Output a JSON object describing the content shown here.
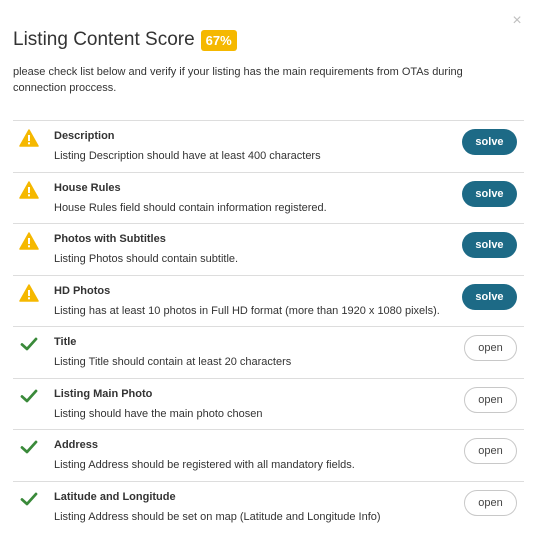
{
  "dialog": {
    "close_glyph": "×",
    "title": "Listing Content Score",
    "score": "67%",
    "subtitle": "please check list below and verify if your listing has the main requirements from OTAs during connection proccess."
  },
  "colors": {
    "warning": "#f5b800",
    "success": "#3a8a3a",
    "solve_button": "#1d6a86",
    "badge": "#f5b800"
  },
  "items": [
    {
      "status": "warning",
      "icon": "warning-icon",
      "title": "Description",
      "description": "Listing Description should have at least 400 characters",
      "action": "solve"
    },
    {
      "status": "warning",
      "icon": "warning-icon",
      "title": "House Rules",
      "description": "House Rules field should contain information registered.",
      "action": "solve"
    },
    {
      "status": "warning",
      "icon": "warning-icon",
      "title": "Photos with Subtitles",
      "description": "Listing Photos should contain subtitle.",
      "action": "solve"
    },
    {
      "status": "warning",
      "icon": "warning-icon",
      "title": "HD Photos",
      "description": "Listing has at least 10 photos in Full HD format (more than 1920 x 1080 pixels).",
      "action": "solve"
    },
    {
      "status": "ok",
      "icon": "checkmark-icon",
      "title": "Title",
      "description": "Listing Title should contain at least 20 characters",
      "action": "open"
    },
    {
      "status": "ok",
      "icon": "checkmark-icon",
      "title": "Listing Main Photo",
      "description": "Listing should have the main photo chosen",
      "action": "open"
    },
    {
      "status": "ok",
      "icon": "checkmark-icon",
      "title": "Address",
      "description": "Listing Address should be registered with all mandatory fields.",
      "action": "open"
    },
    {
      "status": "ok",
      "icon": "checkmark-icon",
      "title": "Latitude and Longitude",
      "description": "Listing Address should be set on map (Latitude and Longitude Info)",
      "action": "open"
    }
  ]
}
